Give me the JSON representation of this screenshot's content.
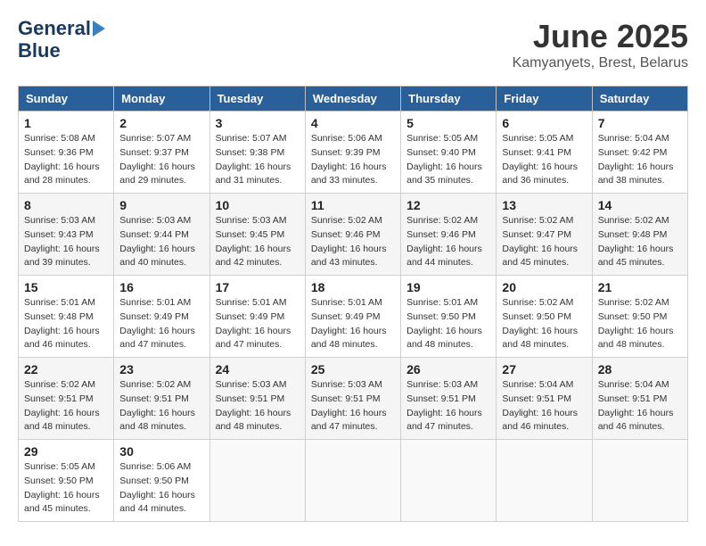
{
  "header": {
    "logo_line1": "General",
    "logo_line2": "Blue",
    "month_title": "June 2025",
    "subtitle": "Kamyanyets, Brest, Belarus"
  },
  "calendar": {
    "days_of_week": [
      "Sunday",
      "Monday",
      "Tuesday",
      "Wednesday",
      "Thursday",
      "Friday",
      "Saturday"
    ],
    "weeks": [
      [
        {
          "day": "1",
          "sunrise": "Sunrise: 5:08 AM",
          "sunset": "Sunset: 9:36 PM",
          "daylight": "Daylight: 16 hours and 28 minutes."
        },
        {
          "day": "2",
          "sunrise": "Sunrise: 5:07 AM",
          "sunset": "Sunset: 9:37 PM",
          "daylight": "Daylight: 16 hours and 29 minutes."
        },
        {
          "day": "3",
          "sunrise": "Sunrise: 5:07 AM",
          "sunset": "Sunset: 9:38 PM",
          "daylight": "Daylight: 16 hours and 31 minutes."
        },
        {
          "day": "4",
          "sunrise": "Sunrise: 5:06 AM",
          "sunset": "Sunset: 9:39 PM",
          "daylight": "Daylight: 16 hours and 33 minutes."
        },
        {
          "day": "5",
          "sunrise": "Sunrise: 5:05 AM",
          "sunset": "Sunset: 9:40 PM",
          "daylight": "Daylight: 16 hours and 35 minutes."
        },
        {
          "day": "6",
          "sunrise": "Sunrise: 5:05 AM",
          "sunset": "Sunset: 9:41 PM",
          "daylight": "Daylight: 16 hours and 36 minutes."
        },
        {
          "day": "7",
          "sunrise": "Sunrise: 5:04 AM",
          "sunset": "Sunset: 9:42 PM",
          "daylight": "Daylight: 16 hours and 38 minutes."
        }
      ],
      [
        {
          "day": "8",
          "sunrise": "Sunrise: 5:03 AM",
          "sunset": "Sunset: 9:43 PM",
          "daylight": "Daylight: 16 hours and 39 minutes."
        },
        {
          "day": "9",
          "sunrise": "Sunrise: 5:03 AM",
          "sunset": "Sunset: 9:44 PM",
          "daylight": "Daylight: 16 hours and 40 minutes."
        },
        {
          "day": "10",
          "sunrise": "Sunrise: 5:03 AM",
          "sunset": "Sunset: 9:45 PM",
          "daylight": "Daylight: 16 hours and 42 minutes."
        },
        {
          "day": "11",
          "sunrise": "Sunrise: 5:02 AM",
          "sunset": "Sunset: 9:46 PM",
          "daylight": "Daylight: 16 hours and 43 minutes."
        },
        {
          "day": "12",
          "sunrise": "Sunrise: 5:02 AM",
          "sunset": "Sunset: 9:46 PM",
          "daylight": "Daylight: 16 hours and 44 minutes."
        },
        {
          "day": "13",
          "sunrise": "Sunrise: 5:02 AM",
          "sunset": "Sunset: 9:47 PM",
          "daylight": "Daylight: 16 hours and 45 minutes."
        },
        {
          "day": "14",
          "sunrise": "Sunrise: 5:02 AM",
          "sunset": "Sunset: 9:48 PM",
          "daylight": "Daylight: 16 hours and 45 minutes."
        }
      ],
      [
        {
          "day": "15",
          "sunrise": "Sunrise: 5:01 AM",
          "sunset": "Sunset: 9:48 PM",
          "daylight": "Daylight: 16 hours and 46 minutes."
        },
        {
          "day": "16",
          "sunrise": "Sunrise: 5:01 AM",
          "sunset": "Sunset: 9:49 PM",
          "daylight": "Daylight: 16 hours and 47 minutes."
        },
        {
          "day": "17",
          "sunrise": "Sunrise: 5:01 AM",
          "sunset": "Sunset: 9:49 PM",
          "daylight": "Daylight: 16 hours and 47 minutes."
        },
        {
          "day": "18",
          "sunrise": "Sunrise: 5:01 AM",
          "sunset": "Sunset: 9:49 PM",
          "daylight": "Daylight: 16 hours and 48 minutes."
        },
        {
          "day": "19",
          "sunrise": "Sunrise: 5:01 AM",
          "sunset": "Sunset: 9:50 PM",
          "daylight": "Daylight: 16 hours and 48 minutes."
        },
        {
          "day": "20",
          "sunrise": "Sunrise: 5:02 AM",
          "sunset": "Sunset: 9:50 PM",
          "daylight": "Daylight: 16 hours and 48 minutes."
        },
        {
          "day": "21",
          "sunrise": "Sunrise: 5:02 AM",
          "sunset": "Sunset: 9:50 PM",
          "daylight": "Daylight: 16 hours and 48 minutes."
        }
      ],
      [
        {
          "day": "22",
          "sunrise": "Sunrise: 5:02 AM",
          "sunset": "Sunset: 9:51 PM",
          "daylight": "Daylight: 16 hours and 48 minutes."
        },
        {
          "day": "23",
          "sunrise": "Sunrise: 5:02 AM",
          "sunset": "Sunset: 9:51 PM",
          "daylight": "Daylight: 16 hours and 48 minutes."
        },
        {
          "day": "24",
          "sunrise": "Sunrise: 5:03 AM",
          "sunset": "Sunset: 9:51 PM",
          "daylight": "Daylight: 16 hours and 48 minutes."
        },
        {
          "day": "25",
          "sunrise": "Sunrise: 5:03 AM",
          "sunset": "Sunset: 9:51 PM",
          "daylight": "Daylight: 16 hours and 47 minutes."
        },
        {
          "day": "26",
          "sunrise": "Sunrise: 5:03 AM",
          "sunset": "Sunset: 9:51 PM",
          "daylight": "Daylight: 16 hours and 47 minutes."
        },
        {
          "day": "27",
          "sunrise": "Sunrise: 5:04 AM",
          "sunset": "Sunset: 9:51 PM",
          "daylight": "Daylight: 16 hours and 46 minutes."
        },
        {
          "day": "28",
          "sunrise": "Sunrise: 5:04 AM",
          "sunset": "Sunset: 9:51 PM",
          "daylight": "Daylight: 16 hours and 46 minutes."
        }
      ],
      [
        {
          "day": "29",
          "sunrise": "Sunrise: 5:05 AM",
          "sunset": "Sunset: 9:50 PM",
          "daylight": "Daylight: 16 hours and 45 minutes."
        },
        {
          "day": "30",
          "sunrise": "Sunrise: 5:06 AM",
          "sunset": "Sunset: 9:50 PM",
          "daylight": "Daylight: 16 hours and 44 minutes."
        },
        null,
        null,
        null,
        null,
        null
      ]
    ]
  }
}
